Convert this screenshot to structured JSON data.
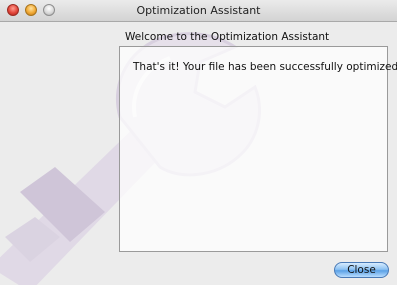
{
  "window": {
    "title": "Optimization Assistant"
  },
  "main": {
    "heading": "Welcome to the Optimization Assistant",
    "message": "That's it! Your file has been successfully optimized."
  },
  "footer": {
    "close_label": "Close"
  },
  "icons": {
    "watermark": "wrench-icon",
    "close_window": "close-window-icon",
    "minimize_window": "minimize-window-icon",
    "zoom_window": "zoom-window-icon"
  },
  "colors": {
    "window_background": "#ececec",
    "wrench_tint": "#c9bad6",
    "button_blue": "#5ba1e6"
  }
}
